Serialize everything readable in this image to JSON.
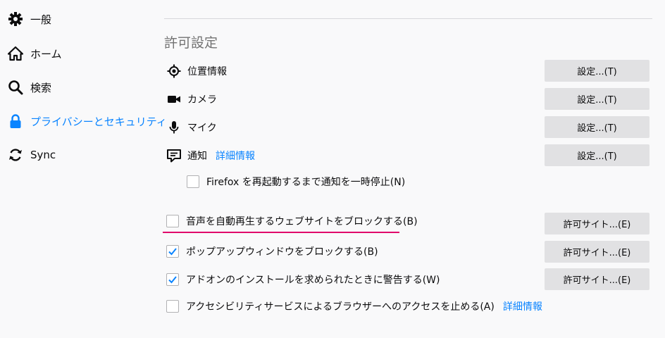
{
  "sidebar": {
    "items": [
      {
        "label": "一般",
        "icon": "gear-icon"
      },
      {
        "label": "ホーム",
        "icon": "home-icon"
      },
      {
        "label": "検索",
        "icon": "search-icon"
      },
      {
        "label": "プライバシーとセキュリティ",
        "icon": "lock-icon",
        "selected": true
      },
      {
        "label": "Sync",
        "icon": "sync-icon"
      }
    ]
  },
  "permissions": {
    "title": "許可設定",
    "items": [
      {
        "label": "位置情報",
        "icon": "location-icon",
        "button": "設定...(T)"
      },
      {
        "label": "カメラ",
        "icon": "camera-icon",
        "button": "設定...(T)"
      },
      {
        "label": "マイク",
        "icon": "microphone-icon",
        "button": "設定...(T)"
      },
      {
        "label": "通知",
        "icon": "notification-icon",
        "link": "詳細情報",
        "button": "設定...(T)"
      }
    ],
    "pause_notifications": {
      "label": "Firefox を再起動するまで通知を一時停止(N)",
      "checked": false
    }
  },
  "blocking": {
    "autoplay": {
      "label": "音声を自動再生するウェブサイトをブロックする(B)",
      "checked": false,
      "button": "許可サイト...(E)"
    },
    "popups": {
      "label": "ポップアップウィンドウをブロックする(B)",
      "checked": true,
      "button": "許可サイト...(E)"
    },
    "addons": {
      "label": "アドオンのインストールを求められたときに警告する(W)",
      "checked": true,
      "button": "許可サイト...(E)"
    },
    "accessibility": {
      "label": "アクセシビリティサービスによるブラウザーへのアクセスを止める(A)",
      "checked": false,
      "link": "詳細情報"
    }
  },
  "colors": {
    "accent": "#0a84ff",
    "highlight": "#e0006b",
    "button_bg": "#e1e1e3"
  }
}
